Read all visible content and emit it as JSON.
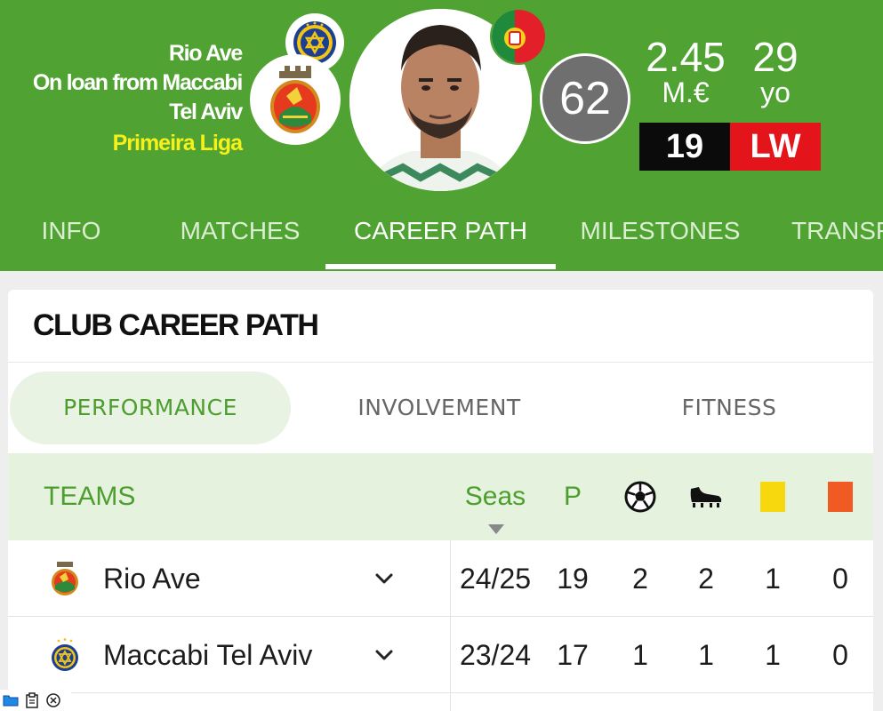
{
  "player": {
    "club_line_1": "Rio Ave",
    "club_line_2": "On loan from Maccabi",
    "club_line_3": "Tel Aviv",
    "league": "Primeira Liga",
    "rating": "62",
    "market_value": "2.45",
    "market_value_unit": "M.€",
    "age": "29",
    "age_unit": "yo",
    "shirt_number": "19",
    "position": "LW",
    "nationality_flag": "portugal-flag-icon"
  },
  "tabs": [
    {
      "label": "INFO"
    },
    {
      "label": "MATCHES"
    },
    {
      "label": "CAREER PATH",
      "active": true
    },
    {
      "label": "MILESTONES"
    },
    {
      "label": "TRANSF"
    }
  ],
  "card": {
    "title": "CLUB CAREER PATH",
    "subtabs": [
      {
        "label": "PERFORMANCE",
        "active": true
      },
      {
        "label": "INVOLVEMENT"
      },
      {
        "label": "FITNESS"
      }
    ],
    "columns": {
      "teams": "TEAMS",
      "seasons": "Seas",
      "played": "P",
      "goals_icon": "football-icon",
      "assists_icon": "boot-icon",
      "yellow_icon": "yellow-card-icon",
      "red_icon": "red-card-icon"
    },
    "rows": [
      {
        "team": "Rio Ave",
        "logo": "rio-ave-crest-icon",
        "season": "24/25",
        "played": "19",
        "goals": "2",
        "assists": "2",
        "yellow": "1",
        "red": "0"
      },
      {
        "team": "Maccabi Tel Aviv",
        "logo": "maccabi-crest-icon",
        "season": "23/24",
        "played": "17",
        "goals": "1",
        "assists": "1",
        "yellow": "1",
        "red": "0"
      }
    ]
  },
  "colors": {
    "header_green": "#50a332",
    "accent_green": "#4d9e2f",
    "league_yellow": "#f6f11b",
    "position_red": "#e4141b",
    "yellow_card": "#f7d80f",
    "red_card": "#f15a22"
  }
}
